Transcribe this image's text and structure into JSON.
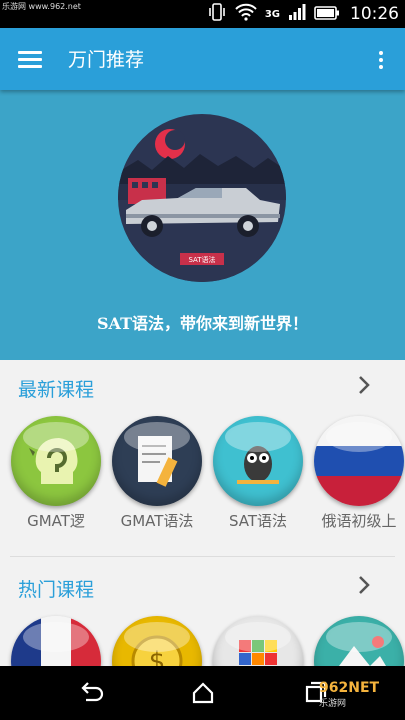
{
  "status": {
    "watermark": "乐游网 www.962.net",
    "time": "10:26",
    "network_label": "3G"
  },
  "app_bar": {
    "title": "万门推荐"
  },
  "banner": {
    "caption": "SAT语法，带你来到新世界！",
    "sign_text": "SAT语法"
  },
  "sections": [
    {
      "title": "最新课程",
      "courses": [
        {
          "label": "GMAT逻",
          "color": "#8cc63f"
        },
        {
          "label": "GMAT语法",
          "color": "#2e3e55"
        },
        {
          "label": "SAT语法",
          "color": "#3fc0d0"
        },
        {
          "label": "俄语初级上",
          "color": "#c0203a"
        }
      ]
    },
    {
      "title": "热门课程",
      "courses": [
        {
          "label": "",
          "color": "#1e3a8a"
        },
        {
          "label": "",
          "color": "#e8b800"
        },
        {
          "label": "",
          "color": "#e7e7e7"
        },
        {
          "label": "",
          "color": "#3bb0a8"
        }
      ]
    }
  ],
  "nav": {
    "logo": "962NET",
    "logo_sub": "乐游网"
  }
}
